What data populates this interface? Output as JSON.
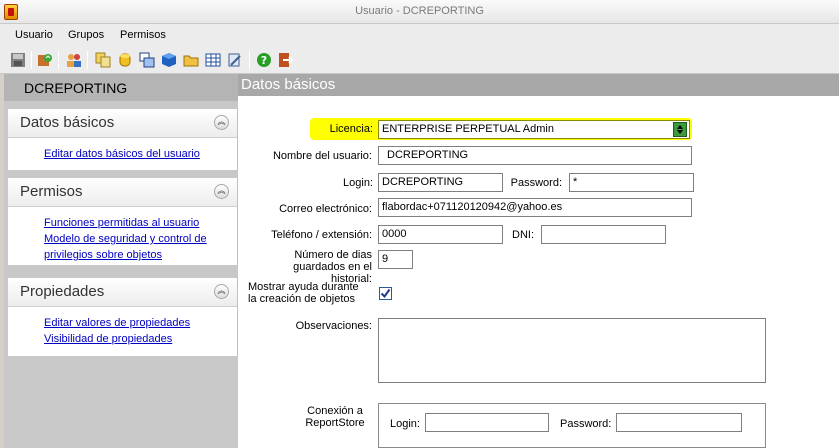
{
  "window": {
    "title": "Usuario -   DCREPORTING"
  },
  "menu": {
    "items": [
      "Usuario",
      "Grupos",
      "Permisos"
    ]
  },
  "toolbar": {
    "icons": [
      "save-icon",
      "refresh-icon",
      "users-icon",
      "copy-icon",
      "database-icon",
      "windows-icon",
      "cube-icon",
      "folder-icon",
      "grid-icon",
      "tools-icon",
      "help-icon",
      "exit-icon"
    ]
  },
  "sidebar": {
    "header": "DCREPORTING",
    "sections": [
      {
        "title": "Datos básicos",
        "links": [
          "Editar datos básicos del usuario"
        ]
      },
      {
        "title": "Permisos",
        "links": [
          "Funciones permitidas al usuario",
          "Modelo de seguridad y control de privilegios sobre objetos"
        ]
      },
      {
        "title": "Propiedades",
        "links": [
          "Editar valores de propiedades",
          "Visibilidad de propiedades"
        ]
      }
    ]
  },
  "main": {
    "header": "Datos básicos",
    "form": {
      "licencia_label": "Licencia:",
      "licencia_value": "ENTERPRISE PERPETUAL Admin",
      "nombre_label": "Nombre del usuario:",
      "nombre_value": "DCREPORTING",
      "login_label": "Login:",
      "login_value": "DCREPORTING",
      "password_label": "Password:",
      "password_value": "*",
      "correo_label": "Correo electrónico:",
      "correo_value": "flabordac+071120120942@yahoo.es",
      "telefono_label": "Teléfono / extensión:",
      "telefono_value": "0000",
      "dni_label": "DNI:",
      "dni_value": "",
      "dias_label": "Número de dias guardados en el historial:",
      "dias_value": "9",
      "ayuda_label": "Mostrar ayuda durante la creación de objetos",
      "ayuda_checked": true,
      "observaciones_label": "Observaciones:",
      "observaciones_value": "",
      "reportstore_label": "Conexión a ReportStore",
      "rs_login_label": "Login:",
      "rs_login_value": "",
      "rs_password_label": "Password:",
      "rs_password_value": ""
    }
  },
  "colors": {
    "highlight": "#ffff00",
    "link": "#0000c0",
    "section_header_bg": "#a8a8a8"
  }
}
